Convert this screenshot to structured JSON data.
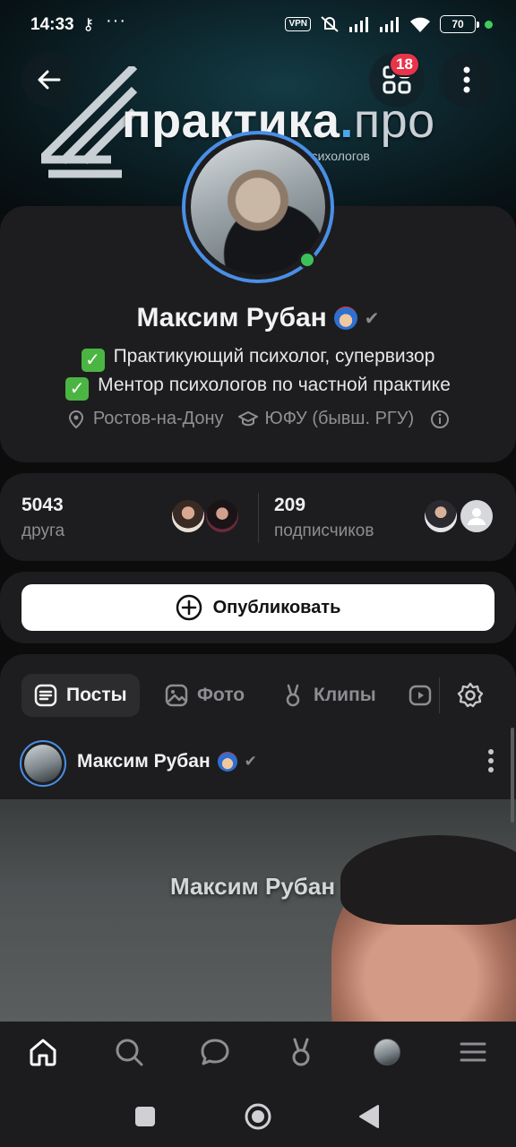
{
  "status_bar": {
    "time": "14:33",
    "key_icon": "⊸",
    "more": "···",
    "vpn": "VPN",
    "battery": "70"
  },
  "cover": {
    "logo_main": "практика",
    "logo_dot": ".",
    "logo_suffix": "про",
    "tagline": "психологов"
  },
  "header": {
    "notifications_count": "18"
  },
  "profile": {
    "name": "Максим Рубан",
    "bio_line1": "Практикующий психолог, супервизор",
    "bio_line2": "Ментор психологов по частной практике",
    "bio_check": "✓",
    "city": "Ростов-на-Дону",
    "university": "ЮФУ (бывш. РГУ)",
    "online": true
  },
  "stats": {
    "friends_count": "5043",
    "friends_label": "друга",
    "followers_count": "209",
    "followers_label": "подписчиков"
  },
  "publish": {
    "label": "Опубликовать"
  },
  "tabs": [
    {
      "label": "Посты",
      "icon": "posts-icon",
      "active": true
    },
    {
      "label": "Фото",
      "icon": "photo-icon",
      "active": false
    },
    {
      "label": "Клипы",
      "icon": "clips-icon",
      "active": false
    }
  ],
  "post": {
    "author": "Максим Рубан",
    "image_caption": "Максим Рубан"
  },
  "colors": {
    "accent": "#4a8fe6",
    "badge": "#e8344a",
    "online": "#3cc15a",
    "card": "#1d1d1f"
  }
}
